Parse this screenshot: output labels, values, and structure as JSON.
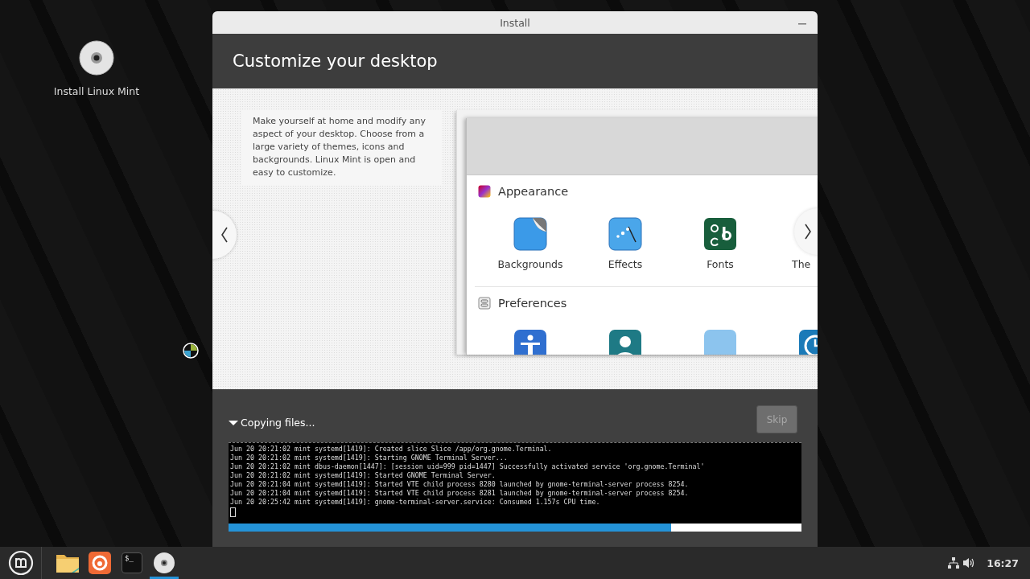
{
  "desktop": {
    "icons": [
      {
        "label": "Install Linux Mint",
        "kind": "disc"
      }
    ]
  },
  "window": {
    "title": "Install"
  },
  "header": {
    "title": "Customize your desktop"
  },
  "slide": {
    "description": "Make yourself at home and modify any aspect of your desktop. Choose from a large variety of themes, icons and backgrounds. Linux Mint is open and easy to customize.",
    "screenshot": {
      "sections": [
        {
          "title": "Appearance",
          "kind": "appearance",
          "items": [
            {
              "label": "Backgrounds",
              "kind": "backgrounds"
            },
            {
              "label": "Effects",
              "kind": "effects"
            },
            {
              "label": "Fonts",
              "kind": "fonts"
            },
            {
              "label": "The",
              "kind": "themes"
            }
          ]
        },
        {
          "title": "Preferences",
          "kind": "preferences",
          "items": [
            {
              "kind": "accessibility"
            },
            {
              "kind": "account"
            },
            {
              "kind": "folder"
            },
            {
              "kind": "clock"
            }
          ]
        }
      ]
    }
  },
  "progress": {
    "status": "Copying files...",
    "expanded": true,
    "skip": {
      "label": "Skip",
      "disabled": true
    },
    "log": [
      "Jun 20 20:21:02 mint systemd[1419]: Created slice Slice /app/org.gnome.Terminal.",
      "Jun 20 20:21:02 mint systemd[1419]: Starting GNOME Terminal Server...",
      "Jun 20 20:21:02 mint dbus-daemon[1447]: [session uid=999 pid=1447] Successfully activated service 'org.gnome.Terminal'",
      "Jun 20 20:21:02 mint systemd[1419]: Started GNOME Terminal Server.",
      "Jun 20 20:21:04 mint systemd[1419]: Started VTE child process 8280 launched by gnome-terminal-server process 8254.",
      "Jun 20 20:21:04 mint systemd[1419]: Started VTE child process 8281 launched by gnome-terminal-server process 8254.",
      "Jun 20 20:25:42 mint systemd[1419]: gnome-terminal-server.service: Consumed 1.157s CPU time."
    ],
    "level": 0.772
  },
  "taskbar": {
    "apps": [
      {
        "kind": "files",
        "active": false
      },
      {
        "kind": "firefox",
        "active": false
      },
      {
        "kind": "terminal",
        "glyph": "$_",
        "active": false
      },
      {
        "kind": "installer",
        "active": true
      }
    ],
    "tray": {
      "clock": "16:27"
    }
  }
}
